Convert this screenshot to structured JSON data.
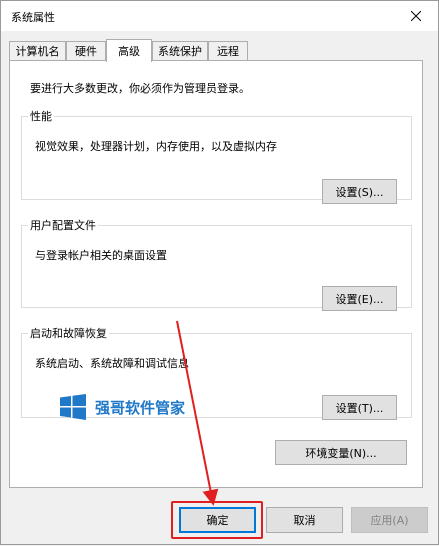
{
  "window": {
    "title": "系统属性",
    "close_icon": "close-icon"
  },
  "tabs": [
    {
      "label": "计算机名",
      "active": false
    },
    {
      "label": "硬件",
      "active": false
    },
    {
      "label": "高级",
      "active": true
    },
    {
      "label": "系统保护",
      "active": false
    },
    {
      "label": "远程",
      "active": false
    }
  ],
  "advanced": {
    "admin_note": "要进行大多数更改，你必须作为管理员登录。",
    "performance": {
      "legend": "性能",
      "description": "视觉效果，处理器计划，内存使用，以及虚拟内存",
      "button": "设置(S)..."
    },
    "user_profiles": {
      "legend": "用户配置文件",
      "description": "与登录帐户相关的桌面设置",
      "button": "设置(E)..."
    },
    "startup_recovery": {
      "legend": "启动和故障恢复",
      "description": "系统启动、系统故障和调试信息",
      "button": "设置(T)..."
    },
    "env_button": "环境变量(N)..."
  },
  "watermark": {
    "text": "强哥软件管家",
    "icon": "windows-logo-icon"
  },
  "footer": {
    "ok": "确定",
    "cancel": "取消",
    "apply": "应用(A)"
  },
  "colors": {
    "highlight": "#e02020",
    "focus": "#0078d7",
    "watermark": "#1f78c8"
  }
}
